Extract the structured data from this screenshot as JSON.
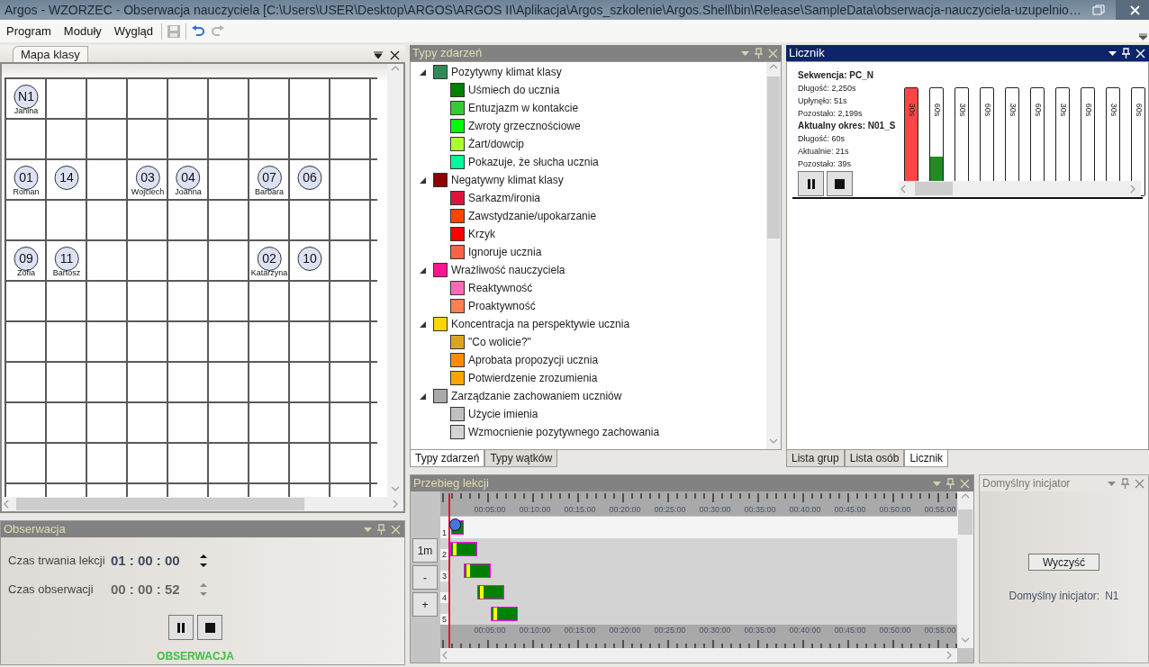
{
  "window": {
    "title": "Argos - WZORZEC - Obserwacja nauczyciela [C:\\Users\\USER\\Desktop\\ARGOS\\ARGOS II\\Aplikacja\\Argos_szkolenie\\Argos.Shell\\bin\\Release\\SampleData\\obserwacja-nauczyciela-uzupelnio…"
  },
  "menu": [
    "Program",
    "Moduły",
    "Wygląd"
  ],
  "toolbar": [
    {
      "kind": "save",
      "disabled": true
    },
    {
      "kind": "undo",
      "disabled": false
    },
    {
      "kind": "redo",
      "disabled": true
    }
  ],
  "class_map": {
    "tab": "Mapa klasy",
    "grid_rows": [
      [
        {
          "kind": "seat",
          "number": "N1",
          "name": "Janina"
        }
      ],
      [
        {
          "kind": "empty"
        }
      ],
      [
        {
          "kind": "seat",
          "number": "01",
          "name": "Roman"
        },
        {
          "kind": "seat",
          "number": "14"
        },
        {
          "kind": "empty"
        },
        {
          "kind": "seat",
          "number": "03",
          "name": "Wojciech"
        },
        {
          "kind": "seat",
          "number": "04",
          "name": "Joanna"
        },
        {
          "kind": "empty"
        },
        {
          "kind": "seat",
          "number": "07",
          "name": "Barbara"
        },
        {
          "kind": "seat",
          "number": "06"
        }
      ],
      [
        {
          "kind": "empty"
        }
      ],
      [
        {
          "kind": "seat",
          "number": "09",
          "name": "Zofia"
        },
        {
          "kind": "seat",
          "number": "11",
          "name": "Bartosz"
        },
        {
          "kind": "empty"
        },
        {
          "kind": "empty"
        },
        {
          "kind": "empty"
        },
        {
          "kind": "empty"
        },
        {
          "kind": "seat",
          "number": "02",
          "name": "Katarzyna"
        },
        {
          "kind": "seat",
          "number": "10"
        }
      ]
    ]
  },
  "observation": {
    "title": "Obserwacja",
    "active": false,
    "fields": [
      {
        "label": "Czas trwania lekcji",
        "value": "01 : 00 : 00",
        "disabled": false
      },
      {
        "label": "Czas obserwacji",
        "value": "00 : 00 : 52",
        "disabled": true
      }
    ],
    "status": "OBSERWACJA"
  },
  "event_types": {
    "title": "Typy zdarzeń",
    "active": false,
    "groups": [
      {
        "label": "Pozytywny klimat klasy",
        "color": "#2e8b57",
        "expanded": true,
        "children": [
          {
            "label": "Uśmiech do ucznia",
            "color": "#008000"
          },
          {
            "label": "Entuzjazm w kontakcie",
            "color": "#32cd32"
          },
          {
            "label": "Zwroty grzecznościowe",
            "color": "#00ff00"
          },
          {
            "label": "Żart/dowcip",
            "color": "#adff2f"
          },
          {
            "label": "Pokazuje, że słucha ucznia",
            "color": "#00fa9a"
          }
        ]
      },
      {
        "label": "Negatywny klimat klasy",
        "color": "#8b0000",
        "expanded": true,
        "children": [
          {
            "label": "Sarkazm/ironia",
            "color": "#dc143c"
          },
          {
            "label": "Zawstydzanie/upokarzanie",
            "color": "#ff4500"
          },
          {
            "label": "Krzyk",
            "color": "#ff0000"
          },
          {
            "label": "Ignoruje ucznia",
            "color": "#ff6347"
          }
        ]
      },
      {
        "label": "Wrażliwość nauczyciela",
        "color": "#ff1493",
        "expanded": true,
        "children": [
          {
            "label": "Reaktywność",
            "color": "#ff69b4"
          },
          {
            "label": "Proaktywność",
            "color": "#ff7f50"
          }
        ]
      },
      {
        "label": "Koncentracja na perspektywie ucznia",
        "color": "#ffd700",
        "expanded": true,
        "children": [
          {
            "label": "\"Co wolicie?\"",
            "color": "#daa520"
          },
          {
            "label": "Aprobata propozycji ucznia",
            "color": "#ff8c00"
          },
          {
            "label": "Potwierdzenie zrozumienia",
            "color": "#ffa500"
          }
        ]
      },
      {
        "label": "Zarządzanie zachowaniem uczniów",
        "color": "#a9a9a9",
        "expanded": true,
        "children": [
          {
            "label": "Użycie imienia",
            "color": "#c0c0c0"
          },
          {
            "label": "Wzmocnienie pozytywnego zachowania",
            "color": "#d3d3d3"
          }
        ]
      }
    ]
  },
  "left_tabs": [
    {
      "label": "Typy zdarzeń",
      "selected": true
    },
    {
      "label": "Typy wątków",
      "selected": false
    }
  ],
  "counter": {
    "title": "Licznik",
    "active": true,
    "sequence": "Sekwencja: PC_N",
    "sequence_lines": [
      "Długość: 2,250s",
      "Upłynęło: 51s",
      "Pozostało: 2,199s"
    ],
    "period": "Aktualny okres: N01_S",
    "period_lines": [
      "Długość: 60s",
      "Aktualnie: 21s",
      "Pozostało: 39s"
    ],
    "bars": [
      {
        "label": "30s",
        "color": "#ff4545",
        "level": 1
      },
      {
        "label": "60s",
        "color": "#228b22",
        "level": 0.36
      },
      {
        "label": "30s"
      },
      {
        "label": "60s"
      },
      {
        "label": "30s"
      },
      {
        "label": "60s"
      },
      {
        "label": "30s"
      },
      {
        "label": "60s"
      },
      {
        "label": "30s"
      },
      {
        "label": "60s"
      }
    ]
  },
  "right_tabs": [
    {
      "label": "Lista grup",
      "selected": false
    },
    {
      "label": "Lista osób",
      "selected": false
    },
    {
      "label": "Licznik",
      "selected": true
    }
  ],
  "timeline": {
    "title": "Przebieg lekcji",
    "active": false,
    "zoom_buttons": [
      "1m",
      "-",
      "+"
    ],
    "top_ruler": [
      "00:05:00",
      "00:10:00",
      "00:15:00",
      "00:20:00",
      "00:25:00",
      "00:30:00",
      "00:35:00",
      "00:40:00",
      "00:45:00",
      "00:50:00",
      "00:55:00"
    ],
    "rows": [
      "1",
      "2",
      "3",
      "4",
      "5"
    ],
    "bottom_ruler": [
      "00:05:00",
      "00:10:00",
      "00:15:00",
      "00:20:00",
      "00:25:00",
      "00:30:00",
      "00:35:00",
      "00:40:00",
      "00:45:00",
      "00:50:00",
      "00:55:00"
    ]
  },
  "initiator": {
    "title": "Domyślny inicjator",
    "button": "Wyczyść",
    "label": "Domyślny inicjator:",
    "value": "N1"
  }
}
